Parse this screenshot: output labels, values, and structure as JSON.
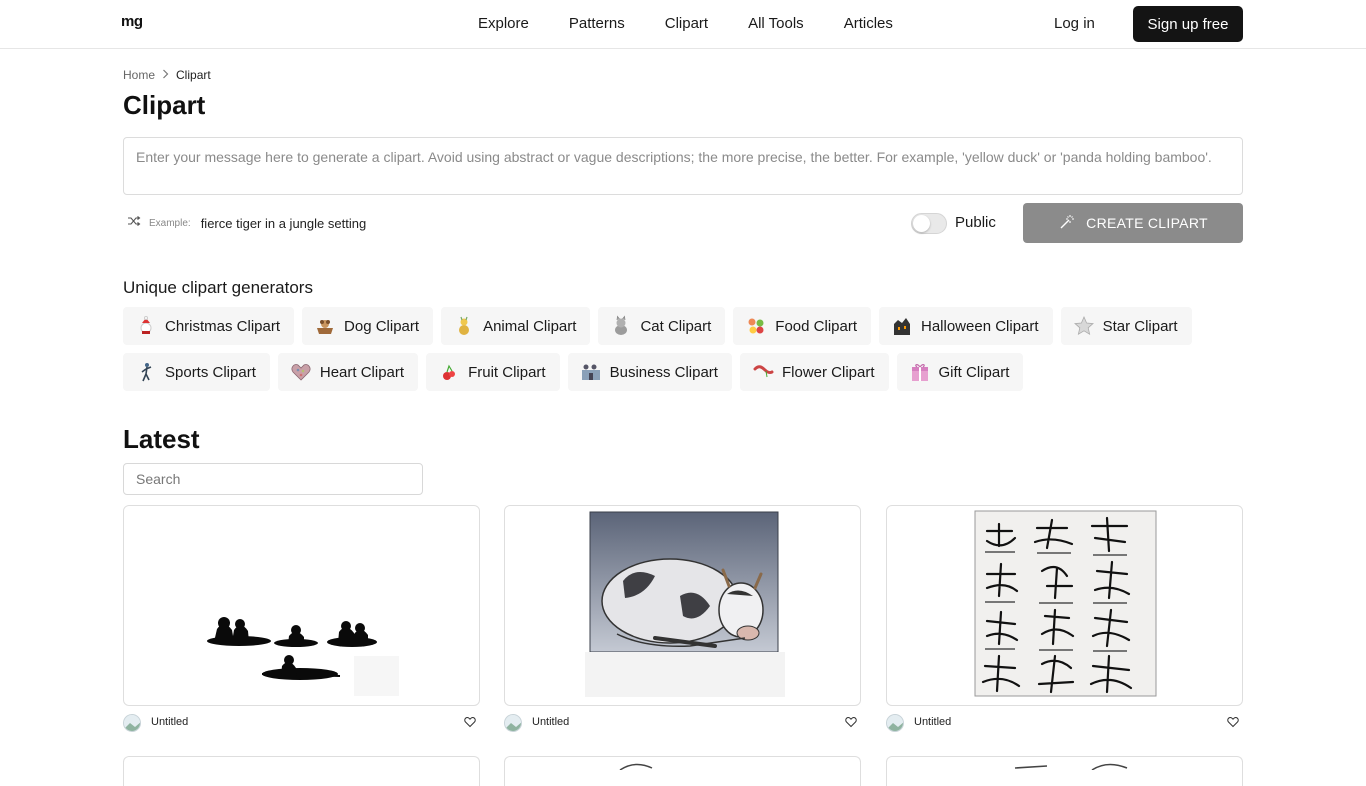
{
  "header": {
    "logo": "mg",
    "nav": [
      "Explore",
      "Patterns",
      "Clipart",
      "All Tools",
      "Articles"
    ],
    "login": "Log in",
    "signup": "Sign up free"
  },
  "breadcrumb": {
    "home": "Home",
    "current": "Clipart"
  },
  "page_title": "Clipart",
  "prompt": {
    "placeholder": "Enter your message here to generate a clipart. Avoid using abstract or vague descriptions; the more precise, the better. For example, 'yellow duck' or 'panda holding bamboo'."
  },
  "example": {
    "label": "Example:",
    "text": "fierce tiger in a jungle setting",
    "icon": "shuffle-icon"
  },
  "visibility": {
    "label": "Public",
    "enabled": false
  },
  "create_button": {
    "label": "CREATE CLIPART",
    "icon": "magic-wand-icon"
  },
  "generators": {
    "title": "Unique clipart generators",
    "rows": [
      [
        {
          "label": "Christmas Clipart",
          "icon": "christmas-icon"
        },
        {
          "label": "Dog Clipart",
          "icon": "dog-icon"
        },
        {
          "label": "Animal Clipart",
          "icon": "animal-icon"
        },
        {
          "label": "Cat Clipart",
          "icon": "cat-icon"
        },
        {
          "label": "Food Clipart",
          "icon": "food-icon"
        },
        {
          "label": "Halloween Clipart",
          "icon": "halloween-icon"
        },
        {
          "label": "Star Clipart",
          "icon": "star-icon"
        }
      ],
      [
        {
          "label": "Sports Clipart",
          "icon": "sports-icon"
        },
        {
          "label": "Heart Clipart",
          "icon": "heart-icon"
        },
        {
          "label": "Fruit Clipart",
          "icon": "fruit-icon"
        },
        {
          "label": "Business Clipart",
          "icon": "business-icon"
        },
        {
          "label": "Flower Clipart",
          "icon": "flower-icon"
        },
        {
          "label": "Gift Clipart",
          "icon": "gift-icon"
        }
      ]
    ]
  },
  "latest": {
    "title": "Latest",
    "search_placeholder": "Search",
    "cards": [
      {
        "name": "Untitled",
        "image": "silhouettes-in-boats-image"
      },
      {
        "name": "Untitled",
        "image": "lying-cow-image"
      },
      {
        "name": "Untitled",
        "image": "calligraphy-sheet-image"
      }
    ]
  },
  "colors": {
    "signup_bg": "#141414",
    "create_bg": "#8b8b8b",
    "chip_bg": "#f6f6f6",
    "border": "#dcdcdc"
  }
}
